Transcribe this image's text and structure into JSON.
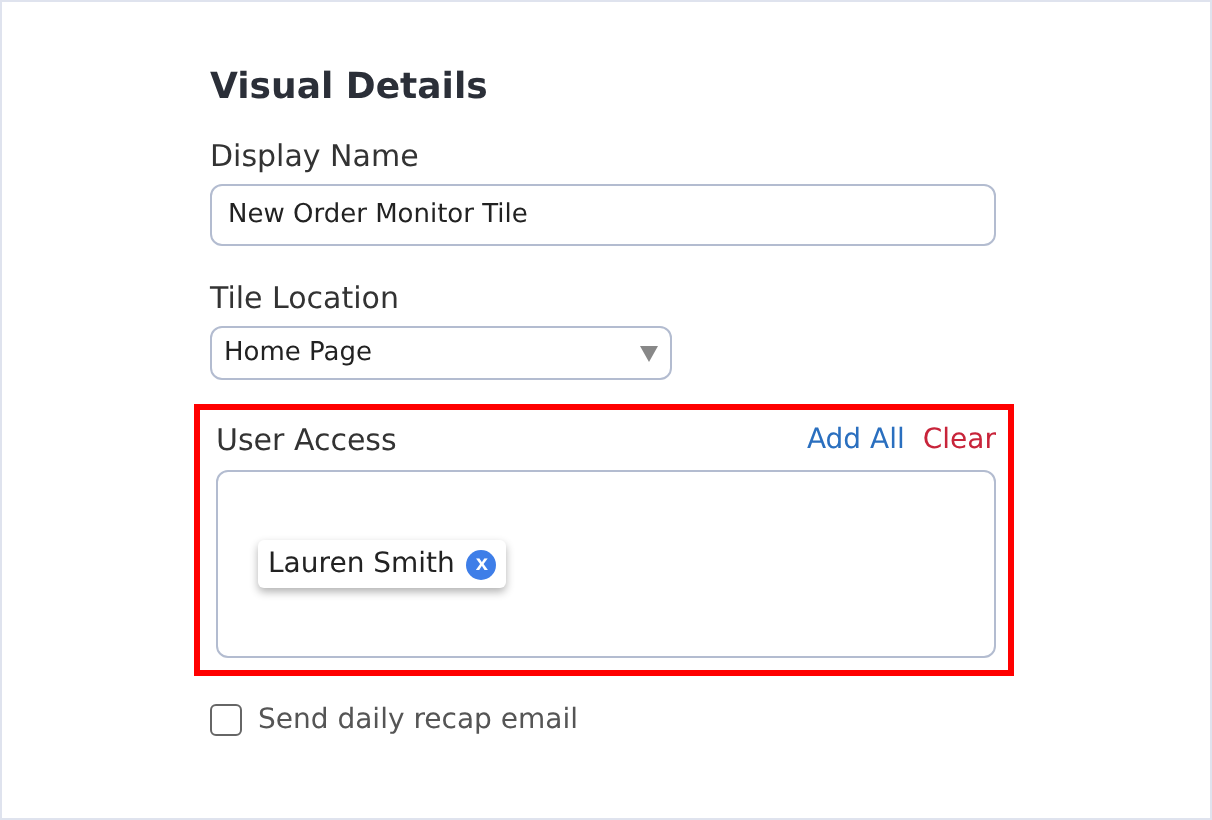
{
  "heading": "Visual Details",
  "display_name": {
    "label": "Display Name",
    "value": "New Order Monitor Tile"
  },
  "tile_location": {
    "label": "Tile Location",
    "value": "Home Page"
  },
  "user_access": {
    "label": "User Access",
    "highlighted": true,
    "actions": [
      {
        "label": "Add All",
        "kind": "add"
      },
      {
        "label": "Clear",
        "kind": "clear"
      }
    ],
    "chips": [
      {
        "label": "Lauren Smith",
        "remove": "x"
      }
    ]
  },
  "recap": {
    "label": "Send daily recap email",
    "checked": false
  }
}
